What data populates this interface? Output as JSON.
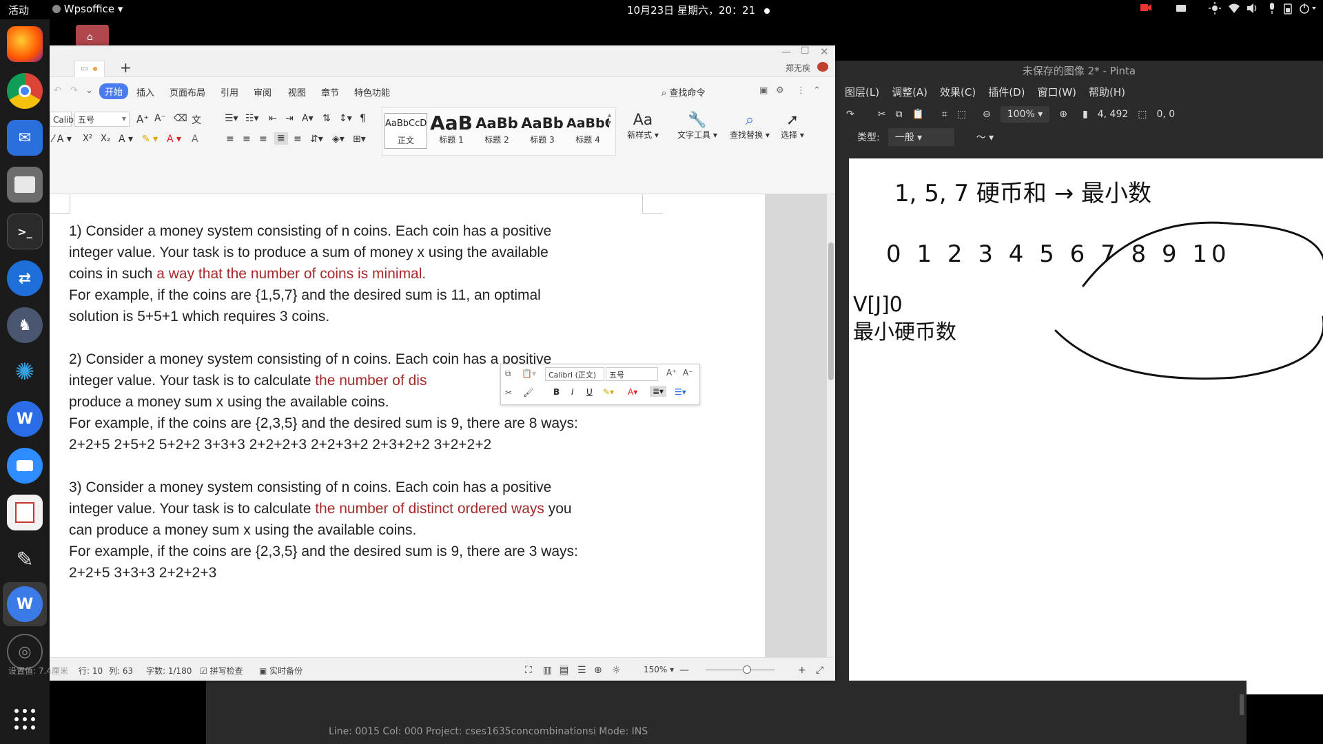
{
  "topbar": {
    "activities": "活动",
    "app_name": "Wpsoffice ▾",
    "clock": "10月23日 星期六，20：21"
  },
  "pinta": {
    "title": "未保存的图像 2* - Pinta",
    "menu": [
      "图层(L)",
      "调整(A)",
      "效果(C)",
      "插件(D)",
      "窗口(W)",
      "帮助(H)"
    ],
    "zoom": "100%",
    "size": "4, 492",
    "selection": "0, 0",
    "type_label": "类型:",
    "type_value": "一般"
  },
  "lower": {
    "status": "Line: 0015   Col: 000   Project: cses1635concombinationsi   Mode: INS"
  },
  "wps": {
    "user": "郑无疾",
    "menu": [
      "开始",
      "插入",
      "页面布局",
      "引用",
      "审阅",
      "视图",
      "章节",
      "特色功能"
    ],
    "search": "查找命令",
    "font_name": "Calibri (正文)",
    "font_size": "五号",
    "styles": [
      {
        "preview": "AaBbCcD",
        "label": "正文"
      },
      {
        "preview": "AaB",
        "label": "标题 1"
      },
      {
        "preview": "AaBb",
        "label": "标题 2"
      },
      {
        "preview": "AaBb",
        "label": "标题 3"
      },
      {
        "preview": "AaBbC",
        "label": "标题 4"
      }
    ],
    "ribbon_buttons": [
      "新样式",
      "文字工具",
      "查找替换",
      "选择"
    ],
    "float_font": "Calibri (正文)",
    "float_size": "五号",
    "status": {
      "setting": "设置值: 7.4厘米",
      "row": "行: 10",
      "col": "列: 63",
      "words": "字数: 1/180",
      "spell": "拼写检查",
      "backup": "实时备份",
      "zoom": "150%"
    }
  },
  "document": {
    "p1_l1": "1)   Consider a money system consisting of n coins. Each coin has a positive",
    "p1_l2": "integer value. Your task is to produce a sum of money x using the available",
    "p1_l3a": "coins in such ",
    "p1_l3b": "a way that the number of coins is minimal.",
    "p1_l4": "For example, if the coins are {1,5,7} and the desired sum is 11, an optimal",
    "p1_l5": "solution is 5+5+1 which requires 3 coins.",
    "p2_l1": "2)   Consider a money system consisting of n coins. Each coin has a positive",
    "p2_l2a": "integer value. Your task is to calculate ",
    "p2_l2b": "the number of dis",
    "p2_l3": "produce a money sum x using the available coins.",
    "p2_l4": "For example, if the coins are {2,3,5} and the desired sum is 9, there are 8 ways:",
    "p2_l5": "2+2+5  2+5+2  5+2+2  3+3+3  2+2+2+3  2+2+3+2  2+3+2+2  3+2+2+2",
    "p3_l1": "3)   Consider a money system consisting of n coins. Each coin has a positive",
    "p3_l2a": "integer value. Your task is to calculate ",
    "p3_l2b": "the number of distinct ordered ways",
    "p3_l2c": " you",
    "p3_l3": "can produce a money sum x using the available coins.",
    "p3_l4": "For example, if the coins are {2,3,5} and the desired sum is 9, there are 3 ways:",
    "p3_l5": "2+2+5  3+3+3  2+2+2+3"
  },
  "handwriting": {
    "line1": "1, 5, 7  硬币和 → 最小数",
    "numbers": "0  1  2  3  4  5  6  7  8  9  10",
    "note1": "V[J]0",
    "note2": "最小硬币数"
  }
}
